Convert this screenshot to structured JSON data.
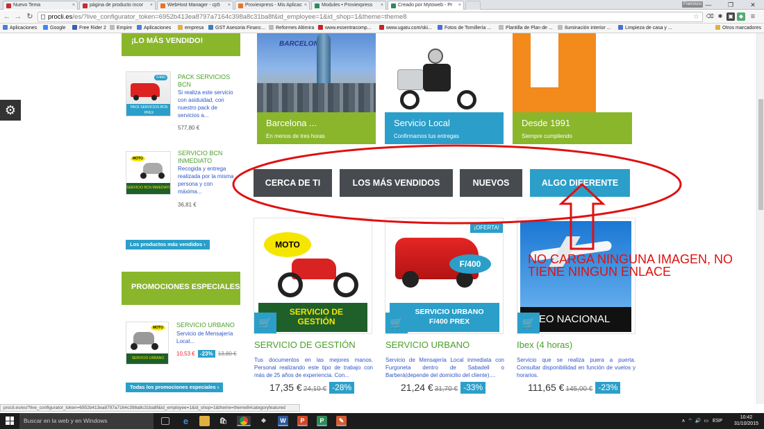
{
  "browser": {
    "tabs": [
      {
        "title": "Nuevo Tema",
        "color": "#c52e2e"
      },
      {
        "title": "página de producto incor",
        "color": "#c52e2e"
      },
      {
        "title": "WebHost Manager - cp5",
        "color": "#e8742a"
      },
      {
        "title": "Proviexpress - Mis Aplicac",
        "color": "#e8742a"
      },
      {
        "title": "Modules • Proviexpress",
        "color": "#2d8a5f"
      },
      {
        "title": "Creado por Mytoweb - Pr",
        "color": "#2d8a5f"
      }
    ],
    "user_badge": "Francisco",
    "url_host": "procli.es",
    "url_path": "/es/?live_configurator_token=6952b413ea8797a7164c398a8c31ba8f&id_employee=1&id_shop=1&theme=theme8",
    "bookmarks": [
      {
        "label": "Aplicaciones",
        "color": "#4a7fd6"
      },
      {
        "label": "Google",
        "color": "#4285f4"
      },
      {
        "label": "Free Rider 2",
        "color": "#3a5fb0"
      },
      {
        "label": "Empire",
        "color": "#888"
      },
      {
        "label": "Aplicaciones",
        "color": "#4a7fd6"
      },
      {
        "label": "empresa",
        "color": "#e0b040"
      },
      {
        "label": "GST Asesoria Financ...",
        "color": "#3a7fc0"
      },
      {
        "label": "Reformes Altimira",
        "color": "#888"
      },
      {
        "label": "www.essentracomp...",
        "color": "#c22"
      },
      {
        "label": "www.ugatu.com/ski...",
        "color": "#c22"
      },
      {
        "label": "Fotos de Tornillería ...",
        "color": "#4a6fd6"
      },
      {
        "label": "Plantilla de Plan de ...",
        "color": "#888"
      },
      {
        "label": "Iluminación interior ...",
        "color": "#888"
      },
      {
        "label": "Limpieza de casa y ...",
        "color": "#4a6fd6"
      },
      {
        "label": "Otros marcadores",
        "color": "#e0b040"
      }
    ]
  },
  "sidebar": {
    "best_heading": "¡LO MÁS VENDIDO!",
    "best_items": [
      {
        "title": "PACK SERVICIOS BCN",
        "desc": "Si realiza este servicio con asiduidad, con nuestro pack de servicios a...",
        "price": "577,80 €",
        "thumb_label": "PACK SERVICIOS BCN PREX",
        "thumb_badge": "F/400"
      },
      {
        "title": "SERVICIO BCN INMEDIATO",
        "desc": "Recogida y entrega realizada por la misma persona y con máxima...",
        "price": "36,81 €",
        "thumb_label": "SERVICIO BCN INMEDIATO",
        "thumb_badge": "MOTO"
      }
    ],
    "best_link": "Los productos más vendidos",
    "promo_heading": "PROMOCIONES ESPECIALES",
    "promo_item": {
      "title": "SERVICIO URBANO",
      "desc": "Servicio de Mensajería Local...",
      "price": "10,53 €",
      "discount": "-23%",
      "old_price": "13,80 €",
      "thumb_label": "SERVICIO URBANO",
      "thumb_badge": "MOTO"
    },
    "promo_link": "Todas los promociones especiales"
  },
  "banners": [
    {
      "title": "Barcelona ...",
      "subtitle": "En menos de tres horas",
      "overlay": "BARCELONA",
      "caption_color": "#8ab62b"
    },
    {
      "title": "Servicio Local",
      "subtitle": "Confirmamos tus entregas",
      "caption_color": "#2b9fc9"
    },
    {
      "title": "Desde 1991",
      "subtitle": "Siempre cumpliendo",
      "caption_color": "#8ab62b"
    }
  ],
  "tabs": [
    {
      "label": "CERCA DE TI",
      "active": false
    },
    {
      "label": "LOS MÁS VENDIDOS",
      "active": false
    },
    {
      "label": "NUEVOS",
      "active": false
    },
    {
      "label": "ALGO DIFERENTE",
      "active": true
    }
  ],
  "annotation": "NO CARGA NINGUNA IMAGEN, NO TIENE NINGUN ENLACE",
  "products": [
    {
      "title": "SERVICIO DE GESTIÓN",
      "desc": "Tus documentos en las mejores manos. Personal realizando este tipo de trabajo con más de 25 años de experiencia. Con...",
      "price": "17,35 €",
      "old_price": "24,10 €",
      "discount": "-28%",
      "badge": "MOTO",
      "label": "SERVICIO DE GESTIÓN"
    },
    {
      "title": "SERVICIO URBANO",
      "desc": "Servicio de Mensajería Local inmediata con Furgoneta dentro de Sabadell o Barberá(depende del domicilio del cliente)....",
      "price": "21,24 €",
      "old_price": "31,70 €",
      "discount": "-33%",
      "badge": "F/400",
      "label": "SERVICIO URBANO F/400 PREX",
      "tag": "¡OFERTA!"
    },
    {
      "title": "Ibex (4 horas)",
      "desc": "Servicio que se realiza puera a puerta. Consultar disponibilidad en función de vuelos y horarios.",
      "price": "111,65 €",
      "old_price": "145,00 €",
      "discount": "-23%",
      "label": "ÉREO NACIONAL"
    }
  ],
  "status_url": "procli.es/es/?live_configurator_token=6952b413ea8797a7164c398a8c31ba8f&id_employee=1&id_shop=1&theme=theme8#categoryfeatured",
  "taskbar": {
    "search_placeholder": "Buscar en la web y en Windows",
    "lang": "ESP",
    "time": "10:42",
    "date": "31/10/2015"
  }
}
